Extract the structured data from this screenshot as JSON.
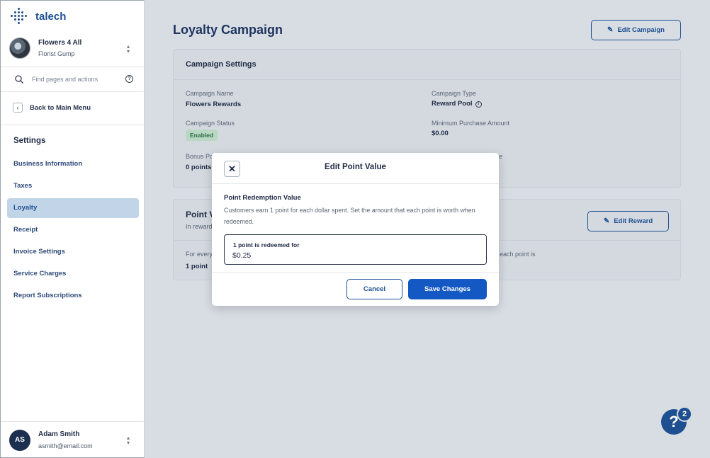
{
  "brand": {
    "name": "talech"
  },
  "store": {
    "name": "Flowers 4 All",
    "sub": "Florist Gump"
  },
  "search": {
    "placeholder": "Find pages and actions"
  },
  "back": {
    "label": "Back to Main Menu"
  },
  "sidebar": {
    "title": "Settings",
    "items": [
      {
        "label": "Business Information"
      },
      {
        "label": "Taxes"
      },
      {
        "label": "Loyalty"
      },
      {
        "label": "Receipt"
      },
      {
        "label": "Invoice Settings"
      },
      {
        "label": "Service Charges"
      },
      {
        "label": "Report Subscriptions"
      }
    ],
    "active_index": 2
  },
  "user": {
    "initials": "AS",
    "name": "Adam Smith",
    "email": "asmith@email.com"
  },
  "page": {
    "title": "Loyalty Campaign",
    "edit_campaign_label": "Edit Campaign"
  },
  "campaign_settings": {
    "title": "Campaign Settings",
    "name_label": "Campaign Name",
    "name_value": "Flowers Rewards",
    "type_label": "Campaign Type",
    "type_value": "Reward Pool",
    "status_label": "Campaign Status",
    "status_value": "Enabled",
    "min_purchase_label": "Minimum Purchase Amount",
    "min_purchase_value": "$0.00",
    "bonus_label_visible": "Bonus Po",
    "bonus_value_visible": "0 points",
    "right_hidden_label_tail": "e"
  },
  "point_value_card": {
    "title_visible": "Point V",
    "sub_visible": "In reward",
    "edit_reward_label": "Edit Reward",
    "row_label_visible": "For every",
    "row_value_visible": "1 point",
    "right_text_visible": "each point is"
  },
  "modal": {
    "title": "Edit Point Value",
    "section_title": "Point Redemption Value",
    "description": "Customers earn 1 point for each dollar spent. Set the amount that each point is worth when redeemed.",
    "field_label": "1 point is redeemed for",
    "field_value": "$0.25",
    "cancel_label": "Cancel",
    "save_label": "Save Changes"
  },
  "help": {
    "label": "?",
    "count": "2"
  },
  "colors": {
    "accent": "#1d4f91",
    "primary_button": "#1458c4",
    "badge_bg": "#b9d8c3",
    "active_nav": "#c2d4e8"
  }
}
